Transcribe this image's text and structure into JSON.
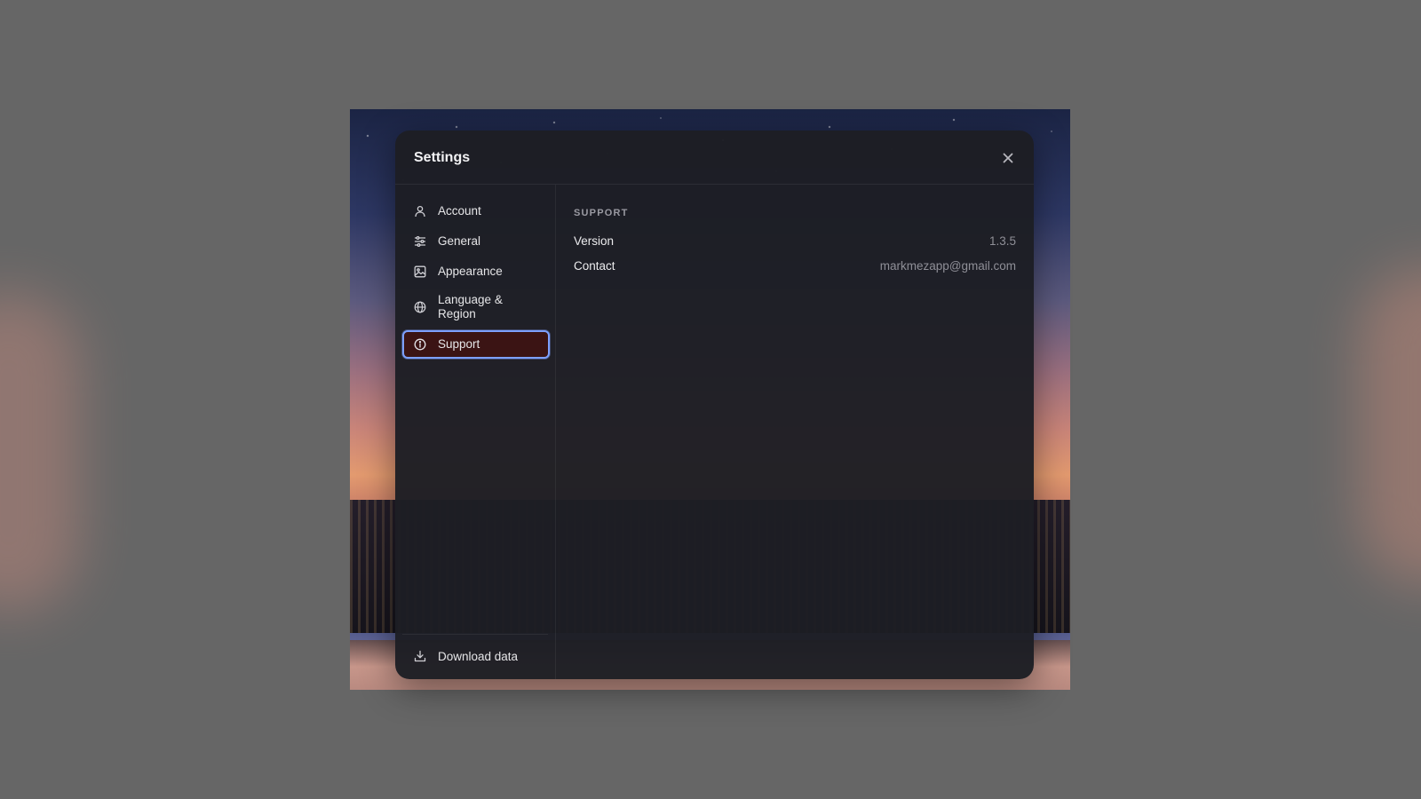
{
  "dialog": {
    "title": "Settings"
  },
  "sidebar": {
    "items": [
      {
        "label": "Account",
        "icon": "user-icon"
      },
      {
        "label": "General",
        "icon": "sliders-icon"
      },
      {
        "label": "Appearance",
        "icon": "image-icon"
      },
      {
        "label": "Language & Region",
        "icon": "globe-icon"
      },
      {
        "label": "Support",
        "icon": "info-icon",
        "active": true
      }
    ],
    "footer": {
      "download_label": "Download data",
      "icon": "download-icon"
    }
  },
  "support": {
    "section_title": "SUPPORT",
    "version_label": "Version",
    "version_value": "1.3.5",
    "contact_label": "Contact",
    "contact_value": "markmezapp@gmail.com"
  },
  "colors": {
    "accent_border": "#7da0ff",
    "active_bg": "#3b1414",
    "dialog_bg": "#1d1e24",
    "overlay": "#666666"
  }
}
